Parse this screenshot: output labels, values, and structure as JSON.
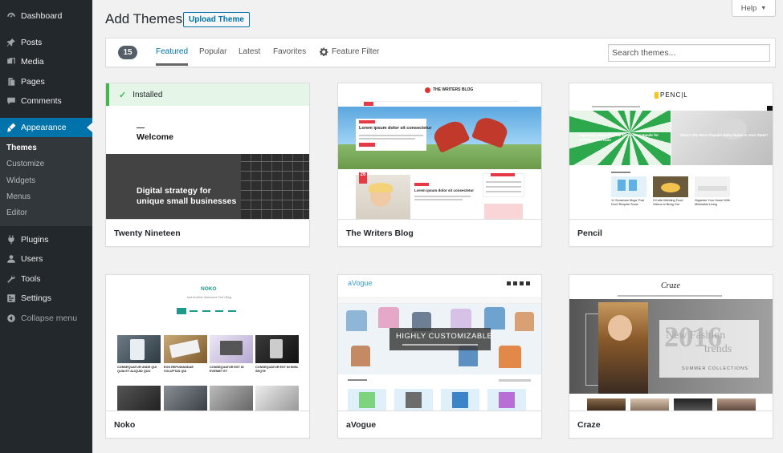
{
  "sidebar": {
    "items": [
      {
        "label": "Dashboard",
        "icon": "dashboard-icon"
      },
      {
        "label": "Posts",
        "icon": "pin-icon"
      },
      {
        "label": "Media",
        "icon": "media-icon"
      },
      {
        "label": "Pages",
        "icon": "pages-icon"
      },
      {
        "label": "Comments",
        "icon": "comment-icon"
      },
      {
        "label": "Appearance",
        "icon": "brush-icon"
      }
    ],
    "submenu": [
      "Themes",
      "Customize",
      "Widgets",
      "Menus",
      "Editor"
    ],
    "items_after": [
      {
        "label": "Plugins",
        "icon": "plug-icon"
      },
      {
        "label": "Users",
        "icon": "user-icon"
      },
      {
        "label": "Tools",
        "icon": "wrench-icon"
      },
      {
        "label": "Settings",
        "icon": "settings-icon"
      }
    ],
    "collapse_label": "Collapse menu"
  },
  "header": {
    "title": "Add Themes",
    "upload_label": "Upload Theme",
    "help_label": "Help",
    "help_arrow": "▼"
  },
  "filter_bar": {
    "count": "15",
    "links": [
      "Featured",
      "Popular",
      "Latest",
      "Favorites"
    ],
    "feature_filter_label": "Feature Filter",
    "search_placeholder": "Search themes..."
  },
  "themes": [
    {
      "name": "Twenty Nineteen",
      "installed": "Installed",
      "welcome": "Welcome",
      "headline_1": "Digital strategy for",
      "headline_2": "unique small businesses"
    },
    {
      "name": "The Writers Blog",
      "brand": "THE WRITERS BLOG",
      "headline": "Lorem ipsum dolor sit consectetur",
      "headline_2": "Lorem ipsum dolor sit consectetur",
      "date_day": "26"
    },
    {
      "name": "Pencil",
      "brand": "PENC|L",
      "caption_1": "Ingenious Umbrella That Frees Your Hands for Texting in the Rain",
      "caption_2": "What's the Most Popular Baby Name in Your State?",
      "caption_3": "11 Snowman Mugs That Don't Require Snow",
      "caption_4": "5 Knife-Wielding Food Videos to Bring Out",
      "caption_5": "Organize Your Home With Minimalist Living"
    },
    {
      "name": "Noko",
      "brand": "NOKO",
      "tagline": "Just Another Awesome Tech Blog",
      "post_1": "CONSEQUATUR UNDE QUI QUIA ET ALIQUID QUO",
      "post_2": "EOS REPUDIANDAE VOLUPTAS QUI",
      "post_3": "CONSEQUATUR EST ID EVENIET ET",
      "post_4": "CONSEQUATUR EST IN NIHIL SEQTE"
    },
    {
      "name": "aVogue",
      "brand": "aVogue",
      "banner": "HIGHLY CUSTOMIZABLE"
    },
    {
      "name": "Craze",
      "brand": "Craze",
      "year": "2016",
      "line_1": "New Fashion",
      "line_2": "trends",
      "line_3": "SUMMER COLLECTIONS"
    }
  ],
  "colors": {
    "sidebar_bg": "#23282d",
    "accent": "#0073aa",
    "installed_green": "#46b450"
  }
}
